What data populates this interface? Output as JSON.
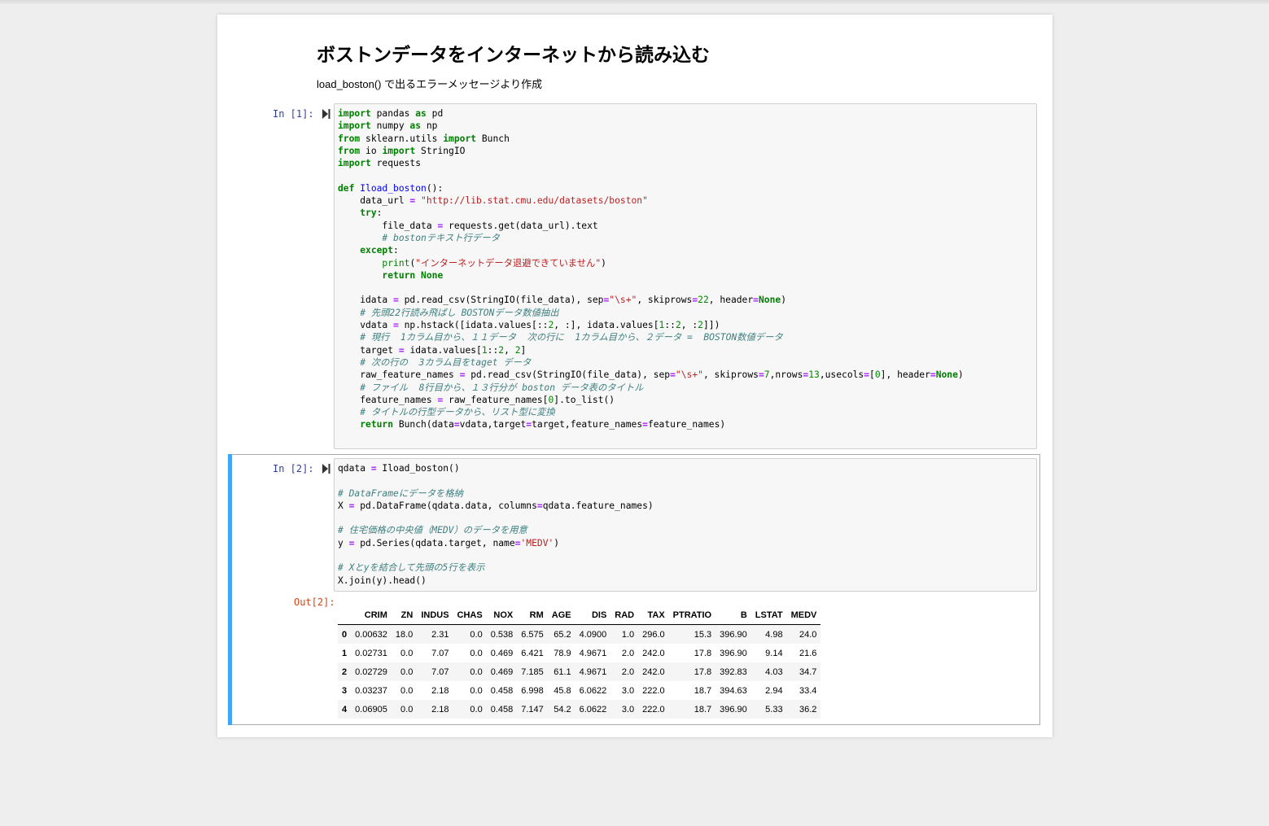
{
  "markdown": {
    "title": "ボストンデータをインターネットから読み込む",
    "subtitle": "load_boston() で出るエラーメッセージより作成"
  },
  "cells": [
    {
      "prompt": "In [1]:",
      "code_lines": [
        "import pandas as pd",
        "import numpy as np",
        "from sklearn.utils import Bunch",
        "from io import StringIO",
        "import requests",
        "",
        "def Iload_boston():",
        "    data_url = \"http://lib.stat.cmu.edu/datasets/boston\"",
        "    try:",
        "        file_data = requests.get(data_url).text",
        "        # bostonテキスト行データ",
        "    except:",
        "        print(\"インターネットデータ退避できていません\")",
        "        return None",
        "",
        "    idata = pd.read_csv(StringIO(file_data), sep=\"\\s+\", skiprows=22, header=None)",
        "    # 先頭22行読み飛ばし BOSTONデータ数値抽出",
        "    vdata = np.hstack([idata.values[::2, :], idata.values[1::2, :2]])",
        "    # 現行  1カラム目から、１１データ  次の行に  1カラム目から、２データ =  BOSTON数値データ",
        "    target = idata.values[1::2, 2]",
        "    # 次の行の  3カラム目をtaget データ",
        "    raw_feature_names = pd.read_csv(StringIO(file_data), sep=\"\\s+\", skiprows=7,nrows=13,usecols=[0], header=None)",
        "    # ファイル  8行目から、１３行分が boston データ表のタイトル",
        "    feature_names = raw_feature_names[0].to_list()",
        "    # タイトルの行型データから、リスト型に変換",
        "    return Bunch(data=vdata,target=target,feature_names=feature_names)"
      ]
    },
    {
      "prompt": "In [2]:",
      "out_prompt": "Out[2]:",
      "code_lines": [
        "qdata = Iload_boston()",
        "",
        "# DataFrameにデータを格納",
        "X = pd.DataFrame(qdata.data, columns=qdata.feature_names)",
        "",
        "# 住宅価格の中央値（MEDV）のデータを用意",
        "y = pd.Series(qdata.target, name='MEDV')",
        "",
        "# Xとyを結合して先頭の5行を表示",
        "X.join(y).head()"
      ]
    }
  ],
  "output_table": {
    "columns": [
      "",
      "CRIM",
      "ZN",
      "INDUS",
      "CHAS",
      "NOX",
      "RM",
      "AGE",
      "DIS",
      "RAD",
      "TAX",
      "PTRATIO",
      "B",
      "LSTAT",
      "MEDV"
    ],
    "rows": [
      [
        "0",
        "0.00632",
        "18.0",
        "2.31",
        "0.0",
        "0.538",
        "6.575",
        "65.2",
        "4.0900",
        "1.0",
        "296.0",
        "15.3",
        "396.90",
        "4.98",
        "24.0"
      ],
      [
        "1",
        "0.02731",
        "0.0",
        "7.07",
        "0.0",
        "0.469",
        "6.421",
        "78.9",
        "4.9671",
        "2.0",
        "242.0",
        "17.8",
        "396.90",
        "9.14",
        "21.6"
      ],
      [
        "2",
        "0.02729",
        "0.0",
        "7.07",
        "0.0",
        "0.469",
        "7.185",
        "61.1",
        "4.9671",
        "2.0",
        "242.0",
        "17.8",
        "392.83",
        "4.03",
        "34.7"
      ],
      [
        "3",
        "0.03237",
        "0.0",
        "2.18",
        "0.0",
        "0.458",
        "6.998",
        "45.8",
        "6.0622",
        "3.0",
        "222.0",
        "18.7",
        "394.63",
        "2.94",
        "33.4"
      ],
      [
        "4",
        "0.06905",
        "0.0",
        "2.18",
        "0.0",
        "0.458",
        "7.147",
        "54.2",
        "6.0622",
        "3.0",
        "222.0",
        "18.7",
        "396.90",
        "5.33",
        "36.2"
      ]
    ]
  },
  "colors": {
    "selected_cell_bar": "#42a5f5",
    "in_prompt": "#303f9f",
    "out_prompt": "#d84315"
  },
  "icons": {
    "run": "run-cell-icon"
  }
}
